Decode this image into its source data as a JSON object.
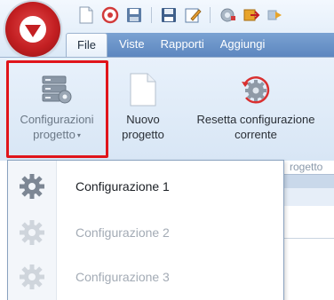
{
  "tabs": {
    "file": "File",
    "viste": "Viste",
    "rapporti": "Rapporti",
    "aggiungi": "Aggiungi"
  },
  "ribbon": {
    "config_label_line1": "Configurazioni",
    "config_label_line2": "progetto",
    "nuovo_line1": "Nuovo",
    "nuovo_line2": "progetto",
    "resetta_line1": "Resetta configurazione",
    "resetta_line2": "corrente",
    "group_label_fragment": "rogetto"
  },
  "menu": {
    "items": [
      {
        "label": "Configurazione 1",
        "enabled": true
      },
      {
        "label": "Configurazione 2",
        "enabled": false
      },
      {
        "label": "Configurazione 3",
        "enabled": false
      }
    ]
  },
  "icons": {
    "app_orb": "app-logo-icon",
    "new_doc": "new-document-icon",
    "open": "open-icon",
    "save": "save-icon",
    "save_disk": "floppy-icon",
    "edit": "edit-icon",
    "gear_small": "gear-small-icon",
    "export": "export-icon",
    "forward": "forward-icon",
    "server_gear": "server-gear-icon",
    "reset_gear": "reset-gear-icon",
    "gear": "gear-icon"
  },
  "colors": {
    "highlight": "#e0151b",
    "tab_active_bg": "#e7f0fa",
    "tab_bar": "#6b93c8",
    "disabled_text": "#a3abb5",
    "brand_red": "#c31f22"
  }
}
